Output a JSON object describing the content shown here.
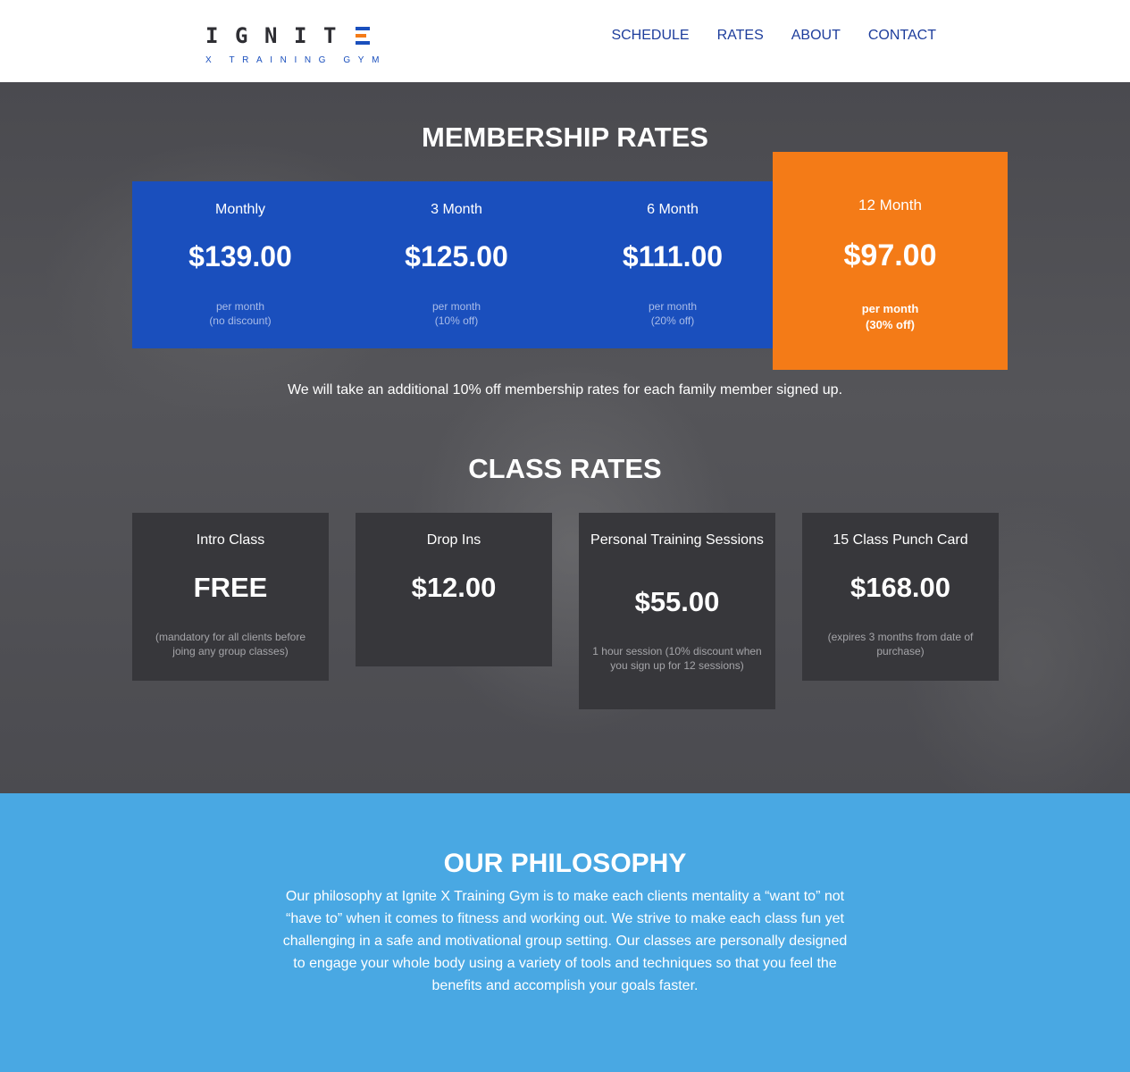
{
  "header": {
    "logo": {
      "letters": [
        "I",
        "G",
        "N",
        "I",
        "T"
      ],
      "subtitle": "X TRAINING GYM"
    },
    "nav": [
      "SCHEDULE",
      "RATES",
      "ABOUT",
      "CONTACT"
    ]
  },
  "membership": {
    "title": "MEMBERSHIP RATES",
    "plans": [
      {
        "name": "Monthly",
        "price": "$139.00",
        "note_line1": "per month",
        "note_line2": "(no discount)"
      },
      {
        "name": "3 Month",
        "price": "$125.00",
        "note_line1": "per month",
        "note_line2": "(10% off)"
      },
      {
        "name": "6 Month",
        "price": "$111.00",
        "note_line1": "per month",
        "note_line2": "(20% off)"
      }
    ],
    "featured": {
      "name": "12 Month",
      "price": "$97.00",
      "note_line1": "per month",
      "note_line2": "(30% off)"
    },
    "family_note": "We will take an additional 10% off membership rates for each family member signed up."
  },
  "classes": {
    "title": "CLASS RATES",
    "items": [
      {
        "name": "Intro Class",
        "price": "FREE",
        "note": "(mandatory for all clients before joing any group classes)"
      },
      {
        "name": "Drop Ins",
        "price": "$12.00",
        "note": ""
      },
      {
        "name": "Personal Training Sessions",
        "price": "$55.00",
        "note": "1 hour session (10% discount when you sign up for 12 sessions)"
      },
      {
        "name": "15 Class Punch Card",
        "price": "$168.00",
        "note": "(expires 3 months from date of purchase)"
      }
    ]
  },
  "philosophy": {
    "title": "OUR PHILOSOPHY",
    "text": "Our philosophy at Ignite X Training Gym is to make each clients mentality a “want to” not “have to” when it comes to fitness and working out. We strive to make each class fun yet challenging in a safe and motivational group setting. Our classes are personally designed to engage your whole body using a variety of tools and techniques so that you feel the benefits and accomplish your goals faster."
  },
  "colors": {
    "brand_blue": "#1a4fbd",
    "brand_orange": "#f47b17",
    "nav_blue": "#1d3d9c",
    "philosophy_bg": "#49a8e3",
    "card_dark": "#37373b"
  }
}
